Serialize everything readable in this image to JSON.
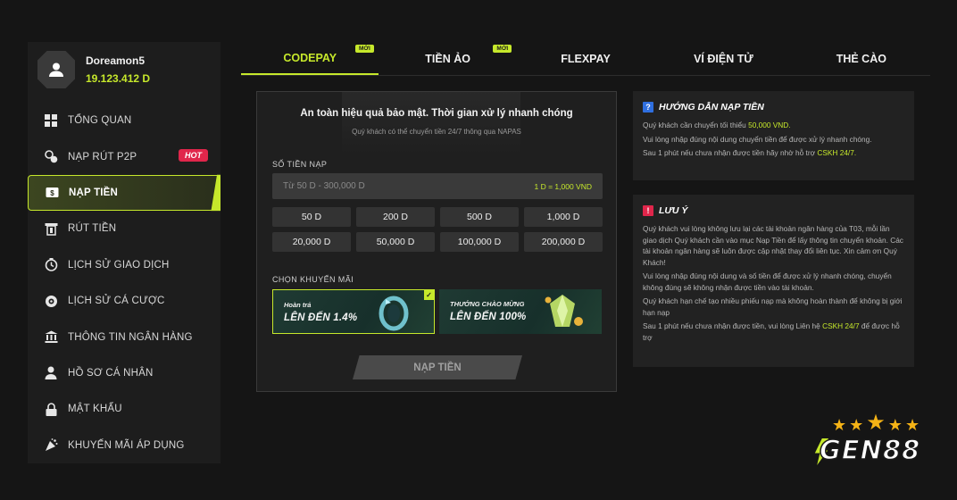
{
  "user": {
    "name": "Doreamon5",
    "balance": "19.123.412 D"
  },
  "sidebar": {
    "items": [
      {
        "label": "TỔNG QUAN",
        "icon": "grid-icon"
      },
      {
        "label": "NẠP RÚT P2P",
        "icon": "coins-icon",
        "badge": "HOT"
      },
      {
        "label": "NẠP TIỀN",
        "icon": "deposit-icon",
        "active": true
      },
      {
        "label": "RÚT TIỀN",
        "icon": "withdraw-icon"
      },
      {
        "label": "LỊCH SỬ GIAO DỊCH",
        "icon": "history-icon"
      },
      {
        "label": "LỊCH SỬ CÁ CƯỢC",
        "icon": "bet-history-icon"
      },
      {
        "label": "THÔNG TIN NGÂN HÀNG",
        "icon": "bank-icon"
      },
      {
        "label": "HỒ SƠ CÁ NHÂN",
        "icon": "profile-icon"
      },
      {
        "label": "MẬT KHẨU",
        "icon": "lock-icon"
      },
      {
        "label": "KHUYẾN MÃI ÁP DỤNG",
        "icon": "promotion-icon"
      }
    ]
  },
  "tabs": [
    {
      "label": "CODEPAY",
      "badge": "MỚI",
      "active": true
    },
    {
      "label": "TIỀN ẢO",
      "badge": "MỚI"
    },
    {
      "label": "FLEXPAY"
    },
    {
      "label": "VÍ ĐIỆN TỬ"
    },
    {
      "label": "THẺ CÀO"
    }
  ],
  "form": {
    "headline": "An toàn hiệu quả bảo mật. Thời gian xử lý nhanh chóng",
    "subline": "Quý khách có thể chuyển tiền 24/7 thông qua NAPAS",
    "amount_label": "SỐ TIỀN NẠP",
    "amount_placeholder": "Từ 50 D - 300,000 D",
    "rate": "1 D = 1,000 VND",
    "amounts": [
      "50 D",
      "200 D",
      "500 D",
      "1,000 D",
      "20,000 D",
      "50,000 D",
      "100,000 D",
      "200,000 D"
    ],
    "promo_label": "CHỌN KHUYẾN MÃI",
    "promos": [
      {
        "title": "Hoàn trả",
        "value": "LÊN ĐẾN 1.4%",
        "selected": true
      },
      {
        "title": "THƯỞNG CHÀO MỪNG",
        "value": "LÊN ĐẾN 100%"
      }
    ],
    "submit_label": "NẠP TIỀN"
  },
  "guide": {
    "icon": "?",
    "title": "HƯỚNG DẪN NẠP TIỀN",
    "line1_pre": "Quý khách cần chuyển tối thiểu ",
    "line1_hl": "50,000 VND.",
    "line2": "Vui lòng nhập đúng nội dung chuyển tiền để được xử lý nhanh chóng.",
    "line3_pre": "Sau 1 phút nếu chưa nhận được tiền hãy nhờ hỗ trợ ",
    "line3_hl": "CSKH 24/7."
  },
  "notes": {
    "icon": "!",
    "title": "LƯU Ý",
    "p1": "Quý khách vui lòng không lưu lại các tài khoản ngân hàng của T03, mỗi lần giao dịch Quý khách cần vào mục Nạp Tiền để lấy thông tin chuyển khoản. Các tài khoản ngân hàng sẽ luôn được cập nhật thay đổi liên tục. Xin cảm ơn Quý Khách!",
    "p2": "Vui lòng nhập đúng nội dung và số tiền để được xử lý nhanh chóng, chuyển không đúng sẽ không nhận được tiền vào tài khoản.",
    "p3": "Quý khách hạn chế tạo nhiều phiếu nạp mà không hoàn thành để không bị giới hạn nạp",
    "p4_pre": "Sau 1 phút nếu chưa nhận được tiền, vui lòng Liên hệ ",
    "p4_hl": "CSKH 24/7",
    "p4_post": " để được hỗ trợ"
  },
  "logo": {
    "text": "GEN88"
  },
  "colors": {
    "accent": "#c6e82b",
    "hot": "#e0264b",
    "guide_icon": "#2f6fe0",
    "note_icon": "#e0264b"
  }
}
